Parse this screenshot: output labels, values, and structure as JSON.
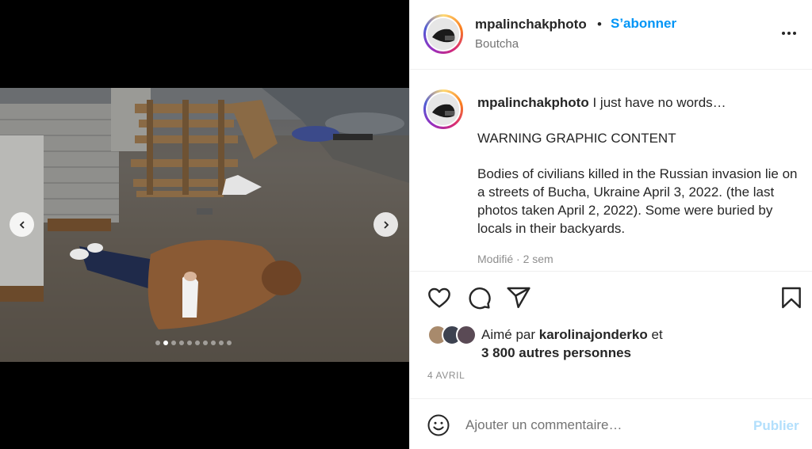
{
  "post": {
    "username": "mpalinchakphoto",
    "separator": "•",
    "follow_label": "S’abonner",
    "location": "Boutcha",
    "more_icon": "more-horizontal-icon"
  },
  "caption": {
    "username": "mpalinchakphoto",
    "line1": "I just have no words…",
    "line2": "WARNING GRAPHIC CONTENT",
    "line3": "Bodies of civilians killed in the Russian invasion lie on a streets of Bucha, Ukraine April 3, 2022. (the last photos taken April 2, 2022). Some were buried by locals in their backyards.",
    "edited": "Modifié · 2 sem"
  },
  "carousel": {
    "prev_icon": "chevron-left-icon",
    "next_icon": "chevron-right-icon",
    "slide_count": 10,
    "active_index": 1
  },
  "actions": {
    "like_icon": "heart-icon",
    "comment_icon": "comment-bubble-icon",
    "share_icon": "paper-plane-icon",
    "save_icon": "bookmark-icon"
  },
  "likes": {
    "prefix": "Aimé par",
    "user": "karolinajonderko",
    "suffix": "et",
    "others": "3 800 autres personnes"
  },
  "date": "4 AVRIL",
  "comment": {
    "placeholder": "Ajouter un commentaire…",
    "publish_label": "Publier",
    "emoji_icon": "smiley-icon"
  },
  "colors": {
    "accent": "#0095f6",
    "publish_disabled": "#b2dffc",
    "muted": "#8e8e8e",
    "text": "#262626"
  }
}
